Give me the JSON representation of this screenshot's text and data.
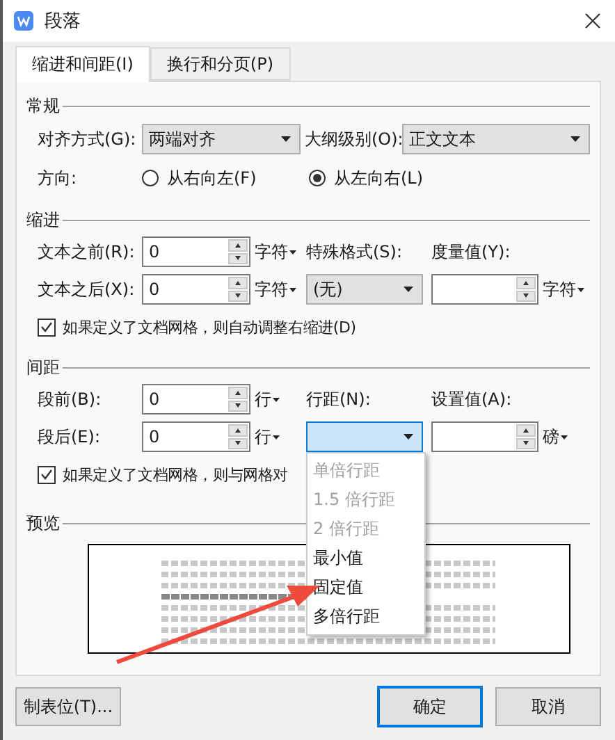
{
  "window": {
    "title": "段落"
  },
  "tabs": [
    {
      "label": "缩进和间距(I)",
      "selected": true
    },
    {
      "label": "换行和分页(P)",
      "selected": false
    }
  ],
  "general": {
    "heading": "常规",
    "alignment": {
      "label": "对齐方式(G):",
      "value": "两端对齐"
    },
    "outline": {
      "label": "大纲级别(O):",
      "value": "正文文本"
    },
    "direction": {
      "label": "方向:",
      "options": [
        {
          "label": "从右向左(F)",
          "selected": false
        },
        {
          "label": "从左向右(L)",
          "selected": true
        }
      ]
    }
  },
  "indent": {
    "heading": "缩进",
    "before": {
      "label": "文本之前(R):",
      "value": "0",
      "unit": "字符"
    },
    "after": {
      "label": "文本之后(X):",
      "value": "0",
      "unit": "字符"
    },
    "special": {
      "label": "特殊格式(S):",
      "value": "(无)"
    },
    "measure": {
      "label": "度量值(Y):",
      "unit": "字符"
    },
    "auto_adjust": {
      "label": "如果定义了文档网格，则自动调整右缩进(D)",
      "checked": true
    }
  },
  "spacing": {
    "heading": "间距",
    "before": {
      "label": "段前(B):",
      "value": "0",
      "unit": "行"
    },
    "after": {
      "label": "段后(E):",
      "value": "0",
      "unit": "行"
    },
    "line_spacing": {
      "label": "行距(N):",
      "focused": true,
      "options": [
        {
          "label": "单倍行距",
          "disabled": true
        },
        {
          "label": "1.5 倍行距",
          "disabled": true
        },
        {
          "label": "2 倍行距",
          "disabled": true
        },
        {
          "label": "最小值",
          "disabled": false
        },
        {
          "label": "固定值",
          "disabled": false
        },
        {
          "label": "多倍行距",
          "disabled": false
        }
      ]
    },
    "set_value": {
      "label": "设置值(A):",
      "unit": "磅"
    },
    "snap_grid": {
      "label": "如果定义了文档网格，则与网格对",
      "checked": true
    }
  },
  "preview": {
    "heading": "预览"
  },
  "buttons": [
    {
      "label": "制表位(T)...",
      "default": false
    },
    {
      "label": "确定",
      "default": true
    },
    {
      "label": "取消",
      "default": false
    }
  ]
}
